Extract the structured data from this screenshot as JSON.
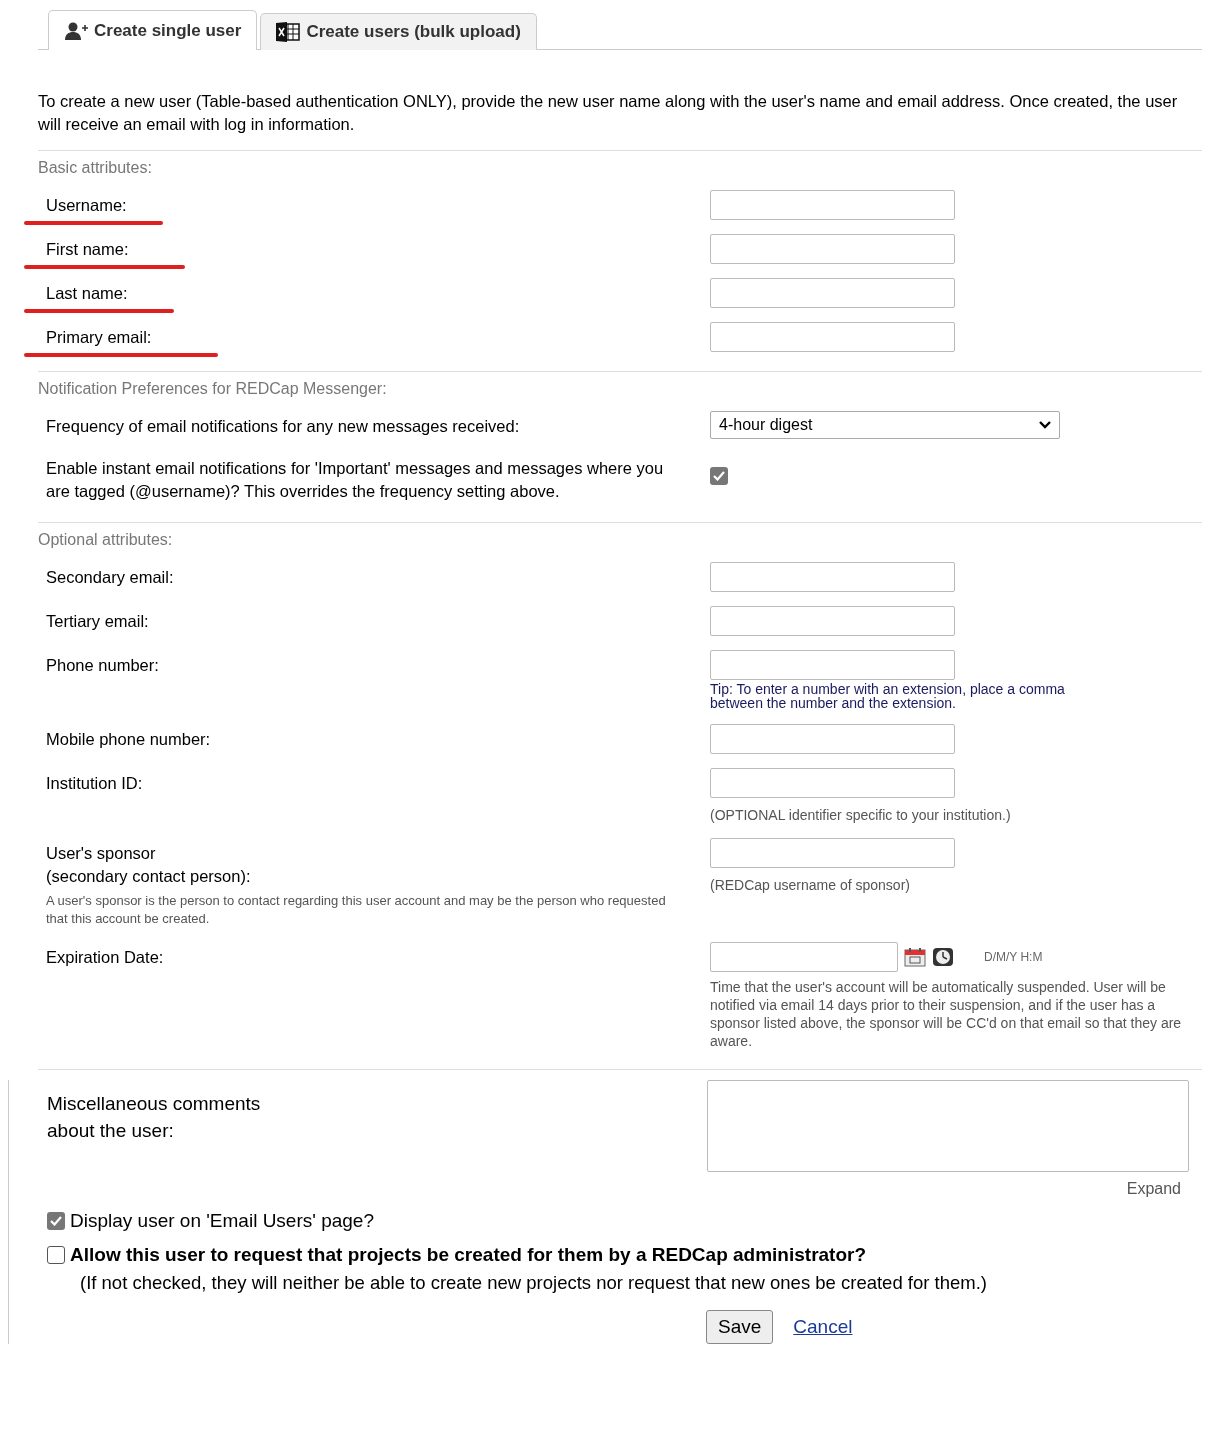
{
  "tabs": [
    {
      "label": "Create single user",
      "selected": true
    },
    {
      "label": "Create users (bulk upload)",
      "selected": false
    }
  ],
  "intro": "To create a new user (Table-based authentication ONLY), provide the new user name along with the user's name and email address. Once created, the user will receive an email with log in information.",
  "sections": [
    {
      "title": "Basic attributes:",
      "rows": [
        {
          "kind": "text",
          "label": "Username:",
          "highlighted": true
        },
        {
          "kind": "text",
          "label": "First name:",
          "highlighted": true
        },
        {
          "kind": "text",
          "label": "Last name:",
          "highlighted": true
        },
        {
          "kind": "text",
          "label": "Primary email:",
          "highlighted": true
        }
      ]
    },
    {
      "title": "Notification Preferences for REDCap Messenger:",
      "rows": [
        {
          "kind": "select",
          "label": "Frequency of email notifications for any new messages received:",
          "value": "4-hour digest"
        },
        {
          "kind": "checkbox",
          "label": "Enable instant email notifications for 'Important' messages and messages where you are tagged (@username)? This overrides the frequency setting above.",
          "checked": true
        }
      ]
    },
    {
      "title": "Optional attributes:",
      "rows": [
        {
          "kind": "text",
          "label": "Secondary email:"
        },
        {
          "kind": "text",
          "label": "Tertiary email:"
        },
        {
          "kind": "text",
          "label": "Phone number:",
          "tip": "Tip: To enter a number with an extension, place a comma between the number and the extension."
        },
        {
          "kind": "text",
          "label": "Mobile phone number:"
        },
        {
          "kind": "text",
          "label": "Institution ID:",
          "note": "(OPTIONAL identifier specific to your institution.)"
        },
        {
          "kind": "text",
          "label": "User's sponsor\n(secondary contact person):",
          "description": "A user's sponsor is the person to contact regarding this user account and may be the person who requested that this account be created.",
          "note": "(REDCap username of sponsor)"
        },
        {
          "kind": "date",
          "label": "Expiration Date:",
          "format": "D/M/Y H:M",
          "note": "Time that the user's account will be automatically suspended. User will be notified via email 14 days prior to their suspension, and if the user has a sponsor listed above, the sponsor will be CC'd on that email so that they are aware."
        }
      ]
    }
  ],
  "comments": {
    "label": "Miscellaneous comments\nabout the user:",
    "expand": "Expand"
  },
  "options": [
    {
      "label": "Display user on 'Email Users' page?",
      "checked": true,
      "bold": false
    },
    {
      "label": "Allow this user to request that projects be created for them by a REDCap administrator?",
      "checked": false,
      "bold": true,
      "note": "(If not checked, they will neither be able to create new projects nor request that new ones be created for them.)"
    }
  ],
  "buttons": {
    "save": "Save",
    "cancel": "Cancel"
  }
}
